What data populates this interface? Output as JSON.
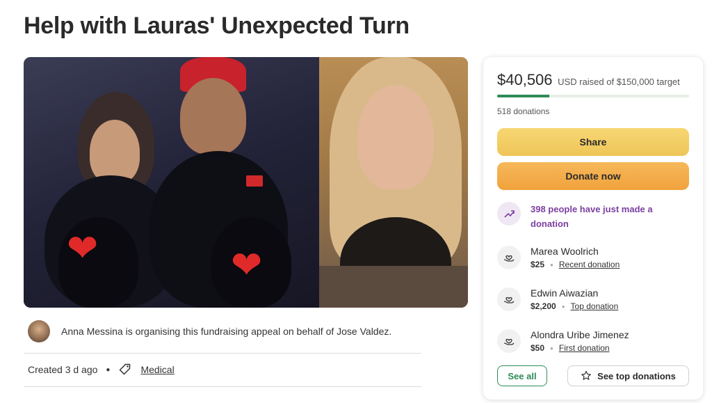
{
  "page": {
    "title": "Help with Lauras' Unexpected Turn"
  },
  "organiser": {
    "text": "Anna Messina is organising this fundraising appeal on behalf of Jose Valdez."
  },
  "meta": {
    "created": "Created 3 d ago",
    "category": "Medical"
  },
  "campaign": {
    "raised_amount": "$40,506",
    "raised_suffix": "USD raised of $150,000 target",
    "progress_fraction": 0.27,
    "donations_count": "518 donations",
    "share_label": "Share",
    "donate_label": "Donate now",
    "activity_text": "398 people have just made a donation"
  },
  "donors": [
    {
      "name": "Marea Woolrich",
      "amount": "$25",
      "label": "Recent donation"
    },
    {
      "name": "Edwin Aiwazian",
      "amount": "$2,200",
      "label": "Top donation"
    },
    {
      "name": "Alondra Uribe Jimenez",
      "amount": "$50",
      "label": "First donation"
    }
  ],
  "actions": {
    "see_all": "See all",
    "see_top": "See top donations"
  },
  "colors": {
    "accent_green": "#2e8b57",
    "share_yellow": "#f2cd63",
    "donate_orange": "#f2a944",
    "activity_purple": "#7b3fa0"
  },
  "icons": [
    "tag-icon",
    "trend-up-icon",
    "heart-hand-icon",
    "star-icon",
    "heart-icon"
  ]
}
